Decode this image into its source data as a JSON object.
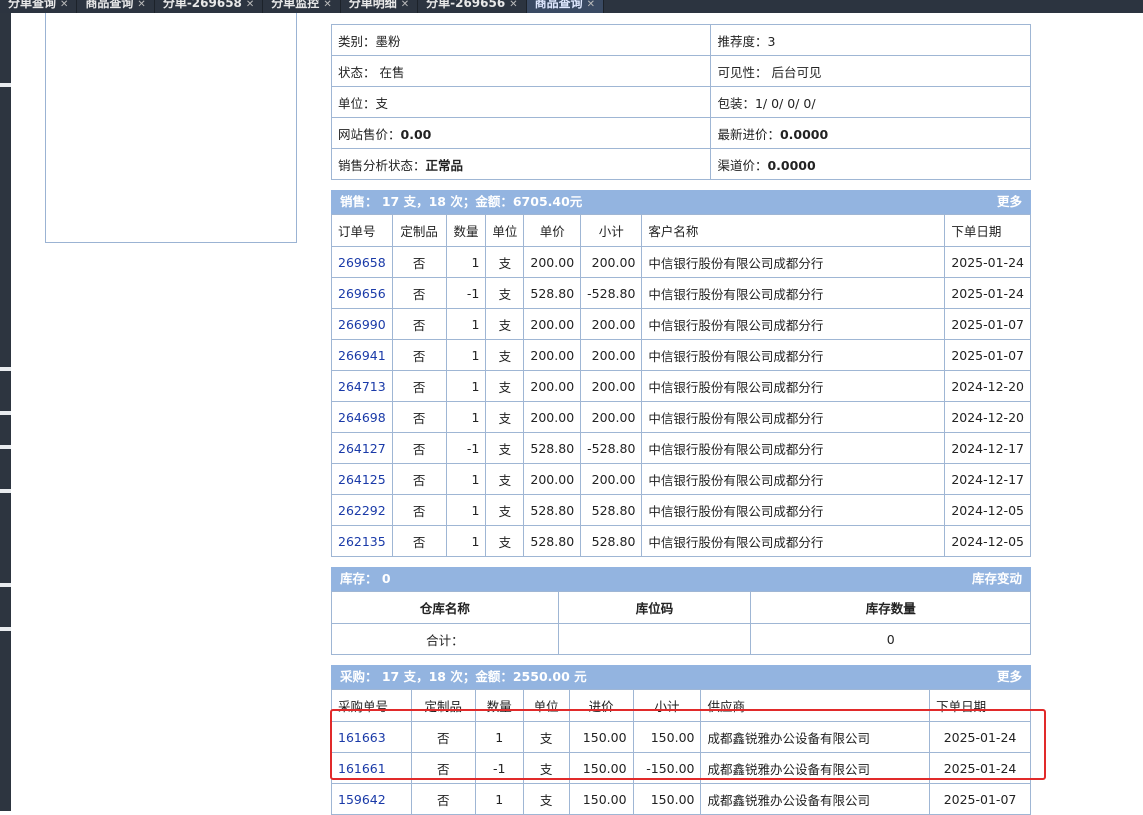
{
  "tabs": [
    {
      "label": "分单查询",
      "active": false
    },
    {
      "label": "商品查询",
      "active": false
    },
    {
      "label": "分单-269658",
      "active": false
    },
    {
      "label": "分单监控",
      "active": false
    },
    {
      "label": "分单明细",
      "active": false
    },
    {
      "label": "分单-269656",
      "active": false
    },
    {
      "label": "商品查询",
      "active": true
    }
  ],
  "info": {
    "rows": [
      {
        "left_label": "类别：",
        "left_value": "墨粉",
        "right_label": "推荐度：",
        "right_value": "3"
      },
      {
        "left_label": "状态：",
        "left_value": "在售",
        "right_label": "可见性：",
        "right_value": "后台可见"
      },
      {
        "left_label": "单位：",
        "left_value": "支",
        "right_label": "包装：",
        "right_value": "1/ 0/ 0/ 0/"
      },
      {
        "left_label": "网站售价：",
        "left_value": "0.00",
        "right_label": "最新进价：",
        "right_value": "0.0000"
      },
      {
        "left_label": "销售分析状态：",
        "left_value": "正常品",
        "right_label": "渠道价：",
        "right_value": "0.0000"
      }
    ]
  },
  "sales": {
    "summary": "销售：  17 支，18 次；金额：6705.40元",
    "more": "更多",
    "headers": [
      "订单号",
      "定制品",
      "数量",
      "单位",
      "单价",
      "小计",
      "客户名称",
      "下单日期"
    ],
    "rows": [
      [
        "269658",
        "否",
        "1",
        "支",
        "200.00",
        "200.00",
        "中信银行股份有限公司成都分行",
        "2025-01-24"
      ],
      [
        "269656",
        "否",
        "-1",
        "支",
        "528.80",
        "-528.80",
        "中信银行股份有限公司成都分行",
        "2025-01-24"
      ],
      [
        "266990",
        "否",
        "1",
        "支",
        "200.00",
        "200.00",
        "中信银行股份有限公司成都分行",
        "2025-01-07"
      ],
      [
        "266941",
        "否",
        "1",
        "支",
        "200.00",
        "200.00",
        "中信银行股份有限公司成都分行",
        "2025-01-07"
      ],
      [
        "264713",
        "否",
        "1",
        "支",
        "200.00",
        "200.00",
        "中信银行股份有限公司成都分行",
        "2024-12-20"
      ],
      [
        "264698",
        "否",
        "1",
        "支",
        "200.00",
        "200.00",
        "中信银行股份有限公司成都分行",
        "2024-12-20"
      ],
      [
        "264127",
        "否",
        "-1",
        "支",
        "528.80",
        "-528.80",
        "中信银行股份有限公司成都分行",
        "2024-12-17"
      ],
      [
        "264125",
        "否",
        "1",
        "支",
        "200.00",
        "200.00",
        "中信银行股份有限公司成都分行",
        "2024-12-17"
      ],
      [
        "262292",
        "否",
        "1",
        "支",
        "528.80",
        "528.80",
        "中信银行股份有限公司成都分行",
        "2024-12-05"
      ],
      [
        "262135",
        "否",
        "1",
        "支",
        "528.80",
        "528.80",
        "中信银行股份有限公司成都分行",
        "2024-12-05"
      ]
    ]
  },
  "stock": {
    "summary": "库存：  0",
    "change": "库存变动",
    "headers": [
      "仓库名称",
      "库位码",
      "库存数量"
    ],
    "total_label": "合计：",
    "total_value": "0"
  },
  "purchase": {
    "summary": "采购：  17 支，18 次；金额：2550.00 元",
    "more": "更多",
    "headers": [
      "采购单号",
      "定制品",
      "数量",
      "单位",
      "进价",
      "小计",
      "供应商",
      "下单日期"
    ],
    "rows": [
      [
        "161663",
        "否",
        "1",
        "支",
        "150.00",
        "150.00",
        "成都鑫锐雅办公设备有限公司",
        "2025-01-24"
      ],
      [
        "161661",
        "否",
        "-1",
        "支",
        "150.00",
        "-150.00",
        "成都鑫锐雅办公设备有限公司",
        "2025-01-24"
      ],
      [
        "159642",
        "否",
        "1",
        "支",
        "150.00",
        "150.00",
        "成都鑫锐雅办公设备有限公司",
        "2025-01-07"
      ]
    ]
  },
  "colors": {
    "header_bg": "#93b4e0",
    "border": "#9fb6d4",
    "link": "#1a3aa8",
    "highlight": "#e12a2a"
  }
}
